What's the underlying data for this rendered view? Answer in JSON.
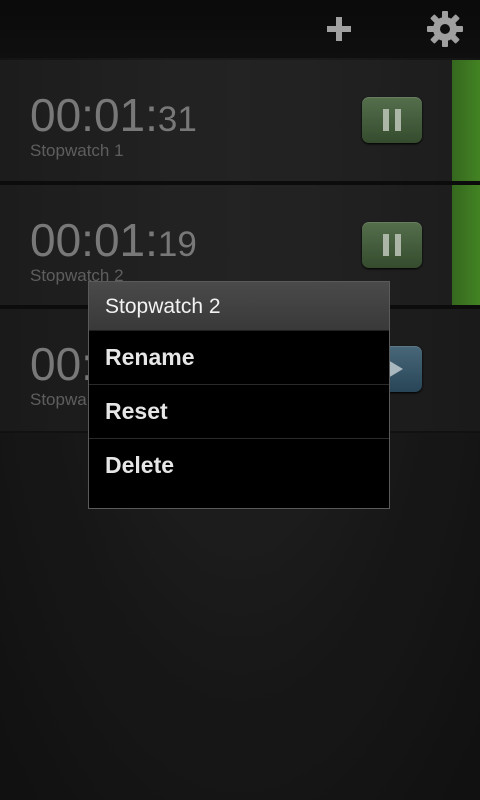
{
  "action_bar": {
    "add_icon": "plus-icon",
    "settings_icon": "gear-icon"
  },
  "stopwatches": [
    {
      "time_main": "00:01:",
      "time_sub": "31",
      "name": "Stopwatch 1",
      "state": "running",
      "control_icon": "pause-icon"
    },
    {
      "time_main": "00:01:",
      "time_sub": "19",
      "name": "Stopwatch 2",
      "state": "running",
      "control_icon": "pause-icon"
    },
    {
      "time_main": "00:",
      "time_sub": "",
      "name": "Stopwa",
      "state": "paused",
      "control_icon": "play-icon"
    }
  ],
  "context_menu": {
    "title": "Stopwatch 2",
    "items": [
      "Rename",
      "Reset",
      "Delete"
    ]
  },
  "colors": {
    "running_accent": "#4f9a2a",
    "pause_button": "#4f6e47",
    "play_button": "#3f6a82",
    "timer_text": "#8d8d8d"
  }
}
